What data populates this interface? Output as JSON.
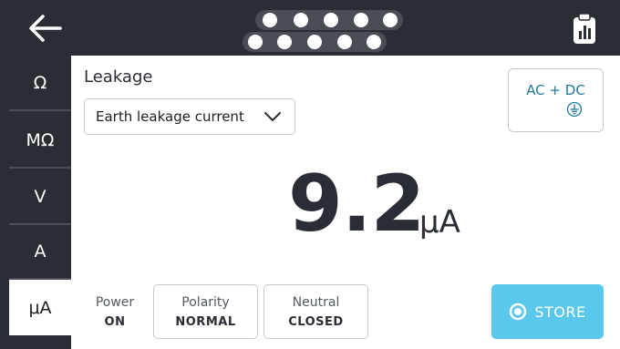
{
  "header": {
    "back_icon": "arrow-left-icon",
    "pins_icon": "connector-pins-icon",
    "report_icon": "clipboard-chart-icon"
  },
  "sidebar": {
    "items": [
      {
        "label": "Ω"
      },
      {
        "label": "MΩ"
      },
      {
        "label": "V"
      },
      {
        "label": "A"
      },
      {
        "label": "μA",
        "active": true
      }
    ]
  },
  "main": {
    "section_title": "Leakage",
    "measurement_select": {
      "value": "Earth leakage current",
      "icon": "chevron-down-icon"
    },
    "mode_button": {
      "label": "AC + DC",
      "icon": "earth-ground-icon"
    },
    "reading": {
      "value": "9.2",
      "unit": "μA"
    },
    "status": {
      "power": {
        "label": "Power",
        "value": "ON"
      },
      "polarity": {
        "label": "Polarity",
        "value": "NORMAL"
      },
      "neutral": {
        "label": "Neutral",
        "value": "CLOSED"
      }
    },
    "store_button": {
      "label": "STORE",
      "icon": "record-circle-icon"
    }
  },
  "colors": {
    "dark": "#2a2d33",
    "accent": "#5ac8ec",
    "mode_text": "#1f7a98"
  }
}
